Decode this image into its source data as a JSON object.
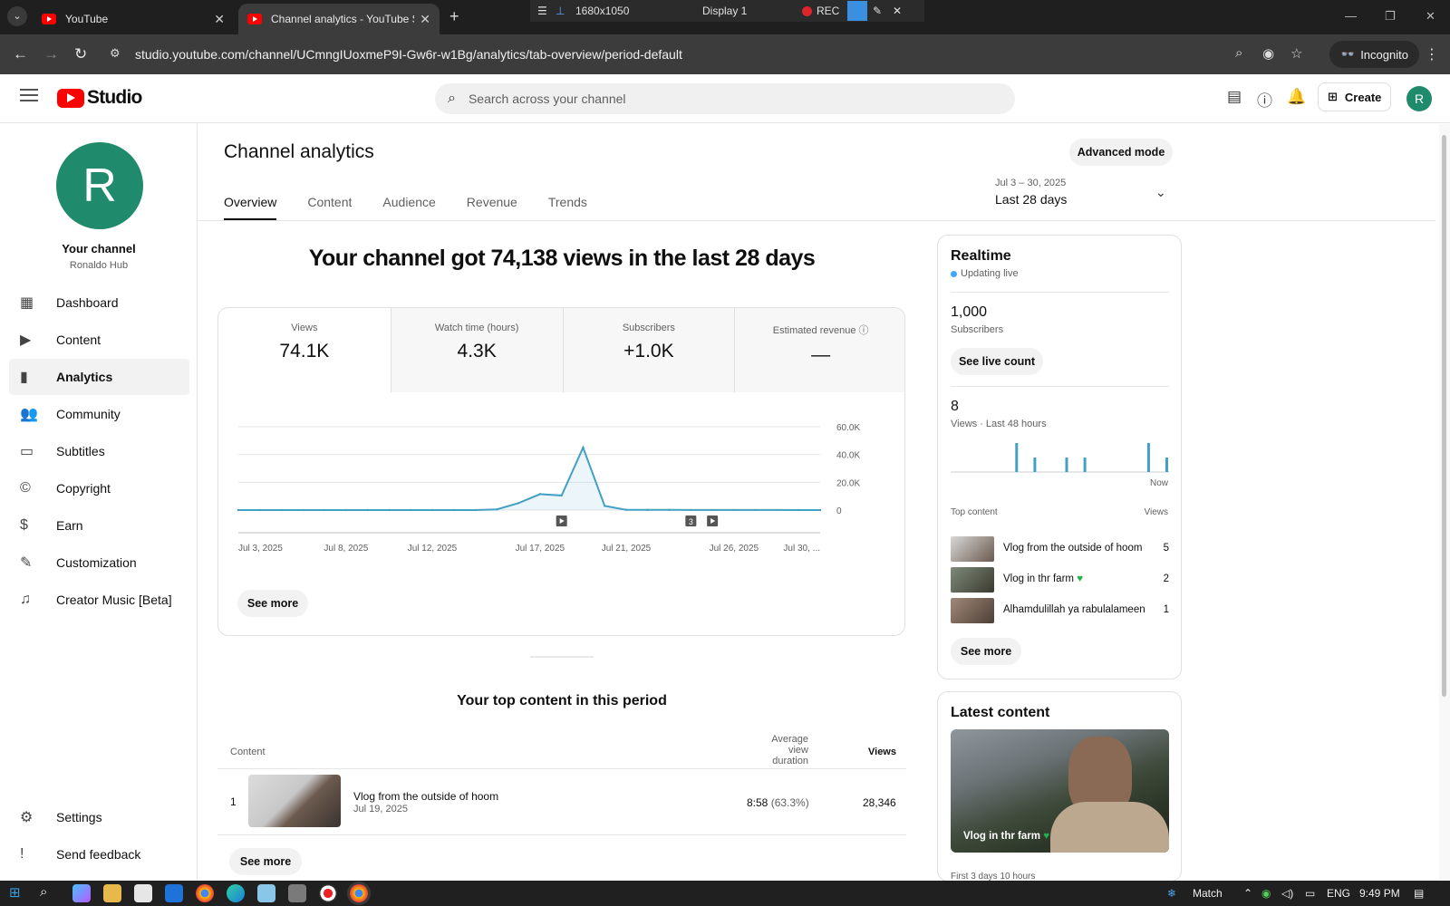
{
  "browser": {
    "tabs": [
      {
        "title": "YouTube"
      },
      {
        "title": "Channel analytics - YouTube Studio"
      }
    ],
    "recorder": {
      "resolution": "1680x1050",
      "display": "Display 1",
      "rec": "REC"
    },
    "url": "studio.youtube.com/channel/UCmngIUoxmeP9I-Gw6r-w1Bg/analytics/tab-overview/period-default",
    "incognito": "Incognito"
  },
  "header": {
    "logo_text": "Studio",
    "search_placeholder": "Search across your channel",
    "create_label": "Create",
    "avatar_letter": "R"
  },
  "sidebar": {
    "avatar_letter": "R",
    "title": "Your channel",
    "channel_name": "Ronaldo Hub",
    "items": [
      {
        "label": "Dashboard",
        "icon": "dashboard-icon"
      },
      {
        "label": "Content",
        "icon": "content-icon"
      },
      {
        "label": "Analytics",
        "icon": "analytics-icon",
        "active": true
      },
      {
        "label": "Community",
        "icon": "community-icon"
      },
      {
        "label": "Subtitles",
        "icon": "subtitles-icon"
      },
      {
        "label": "Copyright",
        "icon": "copyright-icon"
      },
      {
        "label": "Earn",
        "icon": "earn-icon"
      },
      {
        "label": "Customization",
        "icon": "customization-icon"
      },
      {
        "label": "Creator Music [Beta]",
        "icon": "music-icon"
      }
    ],
    "bottom": [
      {
        "label": "Settings",
        "icon": "gear-icon"
      },
      {
        "label": "Send feedback",
        "icon": "feedback-icon"
      }
    ]
  },
  "main": {
    "title": "Channel analytics",
    "advanced_mode": "Advanced mode",
    "date_range": "Jul 3 – 30, 2025",
    "date_label": "Last 28 days",
    "tabs": [
      "Overview",
      "Content",
      "Audience",
      "Revenue",
      "Trends"
    ],
    "headline": "Your channel got 74,138 views in the last 28 days",
    "metrics": [
      {
        "label": "Views",
        "value": "74.1K"
      },
      {
        "label": "Watch time (hours)",
        "value": "4.3K"
      },
      {
        "label": "Subscribers",
        "value": "+1.0K"
      },
      {
        "label": "Estimated revenue",
        "value": "—"
      }
    ],
    "see_more": "See more",
    "top_content": {
      "title": "Your top content in this period",
      "headers": {
        "content": "Content",
        "avg_1": "Average view",
        "avg_2": "duration",
        "views": "Views"
      },
      "rows": [
        {
          "rank": "1",
          "title": "Vlog from the outside of hoom",
          "date": "Jul 19, 2025",
          "duration": "8:58",
          "pct": "(63.3%)",
          "views": "28,346"
        }
      ],
      "see_more": "See more"
    }
  },
  "chart_data": {
    "type": "line",
    "x_tick_labels": [
      "Jul 3, 2025",
      "Jul 8, 2025",
      "Jul 12, 2025",
      "Jul 17, 2025",
      "Jul 21, 2025",
      "Jul 26, 2025",
      "Jul 30, ..."
    ],
    "y_tick_labels": [
      "60.0K",
      "40.0K",
      "20.0K",
      "0"
    ],
    "ylim": [
      0,
      60000
    ],
    "x": [
      "Jul 3",
      "Jul 4",
      "Jul 5",
      "Jul 6",
      "Jul 7",
      "Jul 8",
      "Jul 9",
      "Jul 10",
      "Jul 11",
      "Jul 12",
      "Jul 13",
      "Jul 14",
      "Jul 15",
      "Jul 16",
      "Jul 17",
      "Jul 18",
      "Jul 19",
      "Jul 20",
      "Jul 21",
      "Jul 22",
      "Jul 23",
      "Jul 24",
      "Jul 25",
      "Jul 26",
      "Jul 27",
      "Jul 28",
      "Jul 29",
      "Jul 30"
    ],
    "values": [
      0,
      0,
      0,
      0,
      0,
      0,
      0,
      0,
      0,
      0,
      0,
      0,
      500,
      5000,
      11500,
      10500,
      45000,
      3000,
      200,
      100,
      100,
      50,
      50,
      50,
      50,
      50,
      0,
      0
    ],
    "markers": [
      {
        "x": "Jul 18",
        "label": ""
      },
      {
        "x": "Jul 24",
        "label": "3"
      },
      {
        "x": "Jul 25",
        "label": ""
      }
    ],
    "grid": true,
    "color": "#43a0c3"
  },
  "realtime": {
    "title": "Realtime",
    "status": "Updating live",
    "subscribers_value": "1,000",
    "subscribers_label": "Subscribers",
    "see_live_count": "See live count",
    "views_value": "8",
    "views_label": "Views · Last 48 hours",
    "now_label": "Now",
    "bars": [
      0,
      0,
      0,
      0,
      0,
      0,
      0,
      0,
      0,
      0,
      0,
      0,
      0,
      0,
      2,
      0,
      0,
      0,
      1,
      0,
      0,
      0,
      0,
      0,
      0,
      1,
      0,
      0,
      0,
      1,
      0,
      0,
      0,
      0,
      0,
      0,
      0,
      0,
      0,
      0,
      0,
      0,
      0,
      2,
      0,
      0,
      0,
      1
    ],
    "top_content_label": "Top content",
    "views_col": "Views",
    "items": [
      {
        "title": "Vlog from the outside of hoom",
        "views": "5"
      },
      {
        "title": "Vlog in thr farm",
        "views": "2",
        "heart": true
      },
      {
        "title": "Alhamdulillah ya rabulalameen",
        "views": "1"
      }
    ],
    "see_more": "See more"
  },
  "latest": {
    "title": "Latest content",
    "video_title": "Vlog in thr farm",
    "footer": "First 3 days 10 hours"
  },
  "taskbar": {
    "weather": "Match",
    "lang": "ENG",
    "time": "9:49 PM"
  }
}
